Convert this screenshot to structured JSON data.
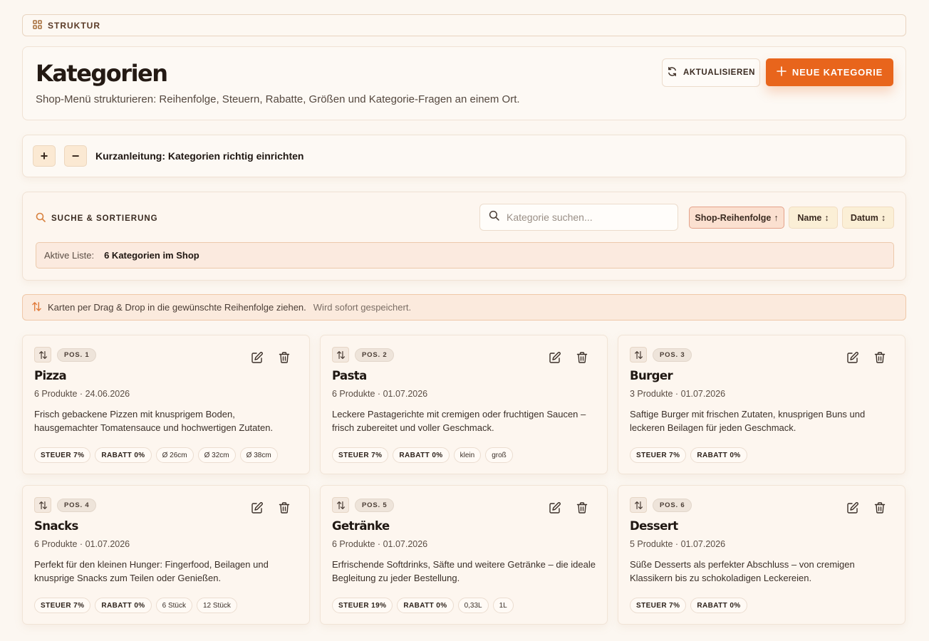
{
  "breadcrumb": {
    "label": "STRUKTUR"
  },
  "header": {
    "title": "Kategorien",
    "subtitle": "Shop-Menü strukturieren: Reihenfolge, Steuern, Rabatte, Größen und Kategorie-Fragen an einem Ort.",
    "refresh_label": "AKTUALISIEREN",
    "new_label": "NEUE KATEGORIE"
  },
  "guide": {
    "plus": "+",
    "minus": "−",
    "title": "Kurzanleitung: Kategorien richtig einrichten"
  },
  "search": {
    "label": "SUCHE & SORTIERUNG",
    "placeholder": "Kategorie suchen...",
    "sort": [
      {
        "label": "Shop-Reihenfolge",
        "arrow": "↑",
        "active": true
      },
      {
        "label": "Name",
        "arrow": "↕",
        "active": false
      },
      {
        "label": "Datum",
        "arrow": "↕",
        "active": false
      }
    ],
    "active_list_key": "Aktive Liste:",
    "active_list_value": "6 Kategorien im Shop"
  },
  "drag_info": {
    "text": "Karten per Drag & Drop in die gewünschte Reihenfolge ziehen.",
    "hint": "Wird sofort gespeichert."
  },
  "colors": {
    "accent": "#e8651c",
    "background": "#fcf7f1",
    "text": "#2a1f18"
  },
  "categories": [
    {
      "pos": "POS. 1",
      "name": "Pizza",
      "meta": "6 Produkte · 24.06.2026",
      "desc": "Frisch gebackene Pizzen mit knusprigem Boden, hausgemachter Tomatensauce und hochwertigen Zutaten.",
      "tax": "STEUER 7%",
      "discount": "RABATT 0%",
      "sizes": [
        "Ø 26cm",
        "Ø 32cm",
        "Ø 38cm"
      ]
    },
    {
      "pos": "POS. 2",
      "name": "Pasta",
      "meta": "6 Produkte · 01.07.2026",
      "desc": "Leckere Pastagerichte mit cremigen oder fruchtigen Saucen – frisch zubereitet und voller Geschmack.",
      "tax": "STEUER 7%",
      "discount": "RABATT 0%",
      "sizes": [
        "klein",
        "groß"
      ]
    },
    {
      "pos": "POS. 3",
      "name": "Burger",
      "meta": "3 Produkte · 01.07.2026",
      "desc": "Saftige Burger mit frischen Zutaten, knusprigen Buns und leckeren Beilagen für jeden Geschmack.",
      "tax": "STEUER 7%",
      "discount": "RABATT 0%",
      "sizes": []
    },
    {
      "pos": "POS. 4",
      "name": "Snacks",
      "meta": "6 Produkte · 01.07.2026",
      "desc": "Perfekt für den kleinen Hunger: Fingerfood, Beilagen und knusprige Snacks zum Teilen oder Genießen.",
      "tax": "STEUER 7%",
      "discount": "RABATT 0%",
      "sizes": [
        "6 Stück",
        "12 Stück"
      ]
    },
    {
      "pos": "POS. 5",
      "name": "Getränke",
      "meta": "6 Produkte · 01.07.2026",
      "desc": "Erfrischende Softdrinks, Säfte und weitere Getränke – die ideale Begleitung zu jeder Bestellung.",
      "tax": "STEUER 19%",
      "discount": "RABATT 0%",
      "sizes": [
        "0,33L",
        "1L"
      ]
    },
    {
      "pos": "POS. 6",
      "name": "Dessert",
      "meta": "5 Produkte · 01.07.2026",
      "desc": "Süße Desserts als perfekter Abschluss – von cremigen Klassikern bis zu schokoladigen Leckereien.",
      "tax": "STEUER 7%",
      "discount": "RABATT 0%",
      "sizes": []
    }
  ]
}
